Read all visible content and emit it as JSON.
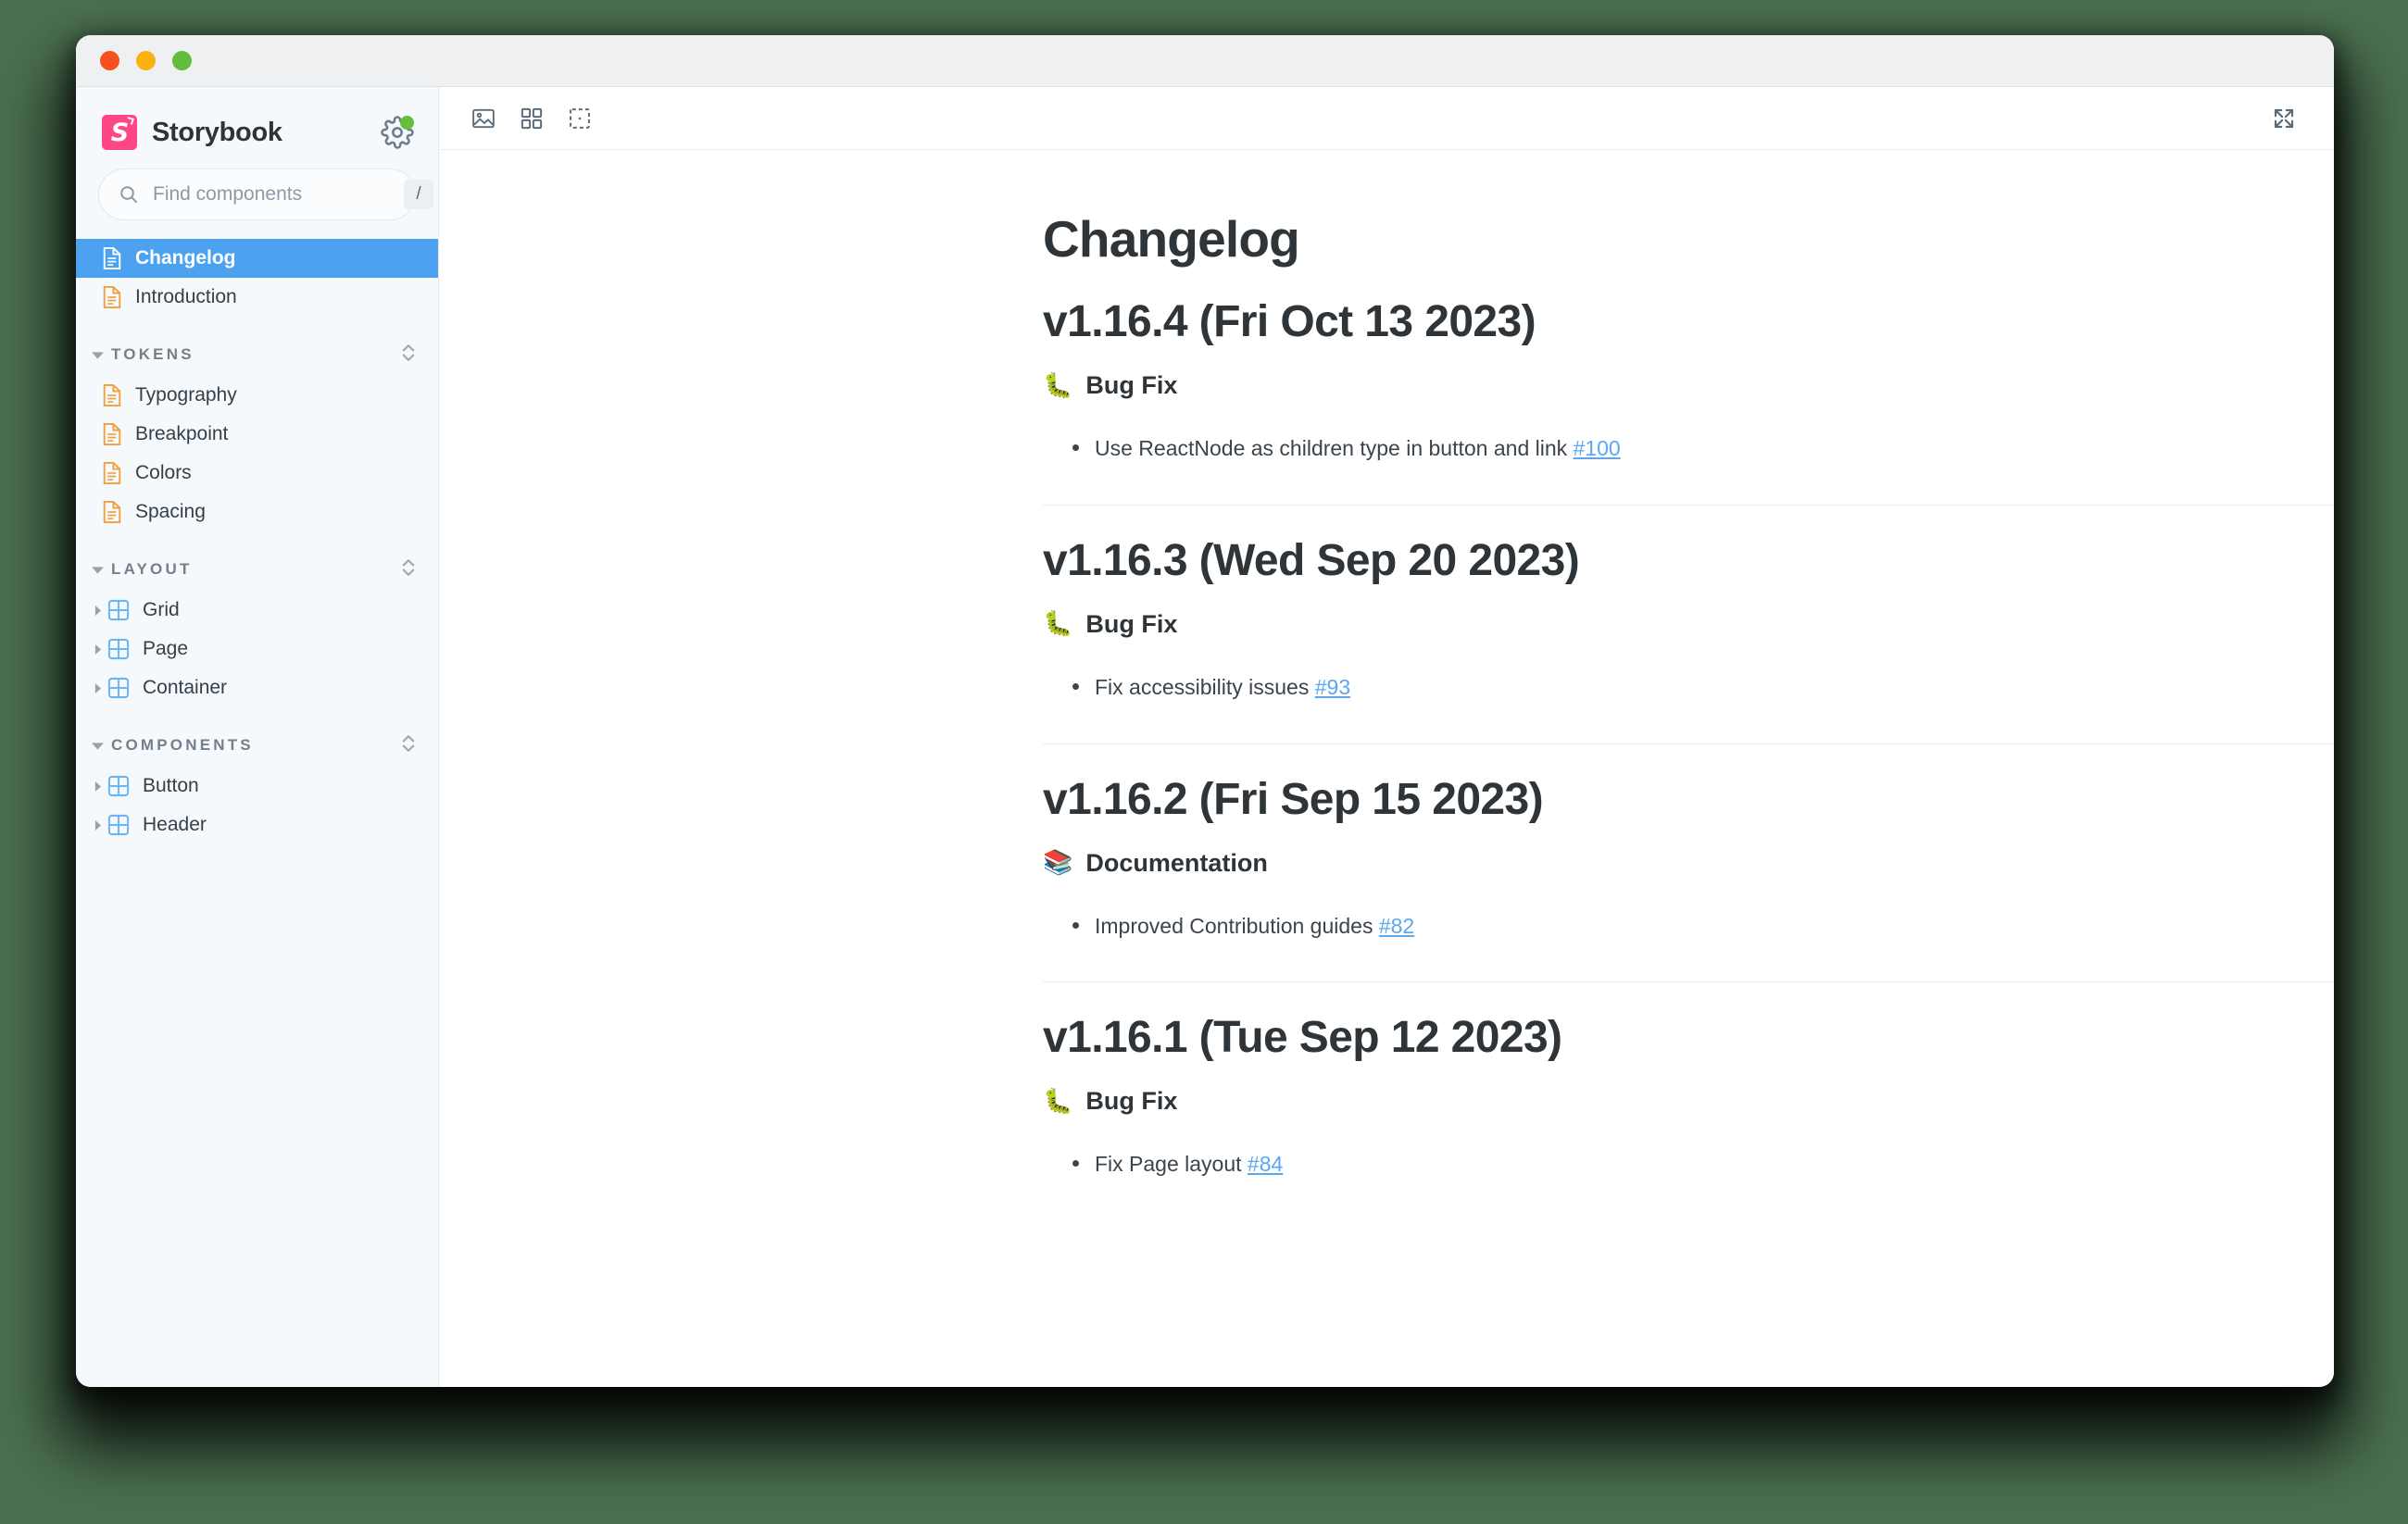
{
  "window": {
    "traffic_lights": [
      "close",
      "minimize",
      "zoom"
    ]
  },
  "sidebar": {
    "brand": "Storybook",
    "logo_mark": "S",
    "settings_icon": "gear-icon",
    "status_dot_color": "#66bf3c",
    "search": {
      "placeholder": "Find components",
      "value": "",
      "shortcut": "/"
    },
    "root_items": [
      {
        "label": "Changelog",
        "icon": "document-icon",
        "active": true
      },
      {
        "label": "Introduction",
        "icon": "document-icon",
        "active": false
      }
    ],
    "groups": [
      {
        "title": "TOKENS",
        "expanded": true,
        "items": [
          {
            "label": "Typography",
            "icon": "document-icon",
            "type": "doc"
          },
          {
            "label": "Breakpoint",
            "icon": "document-icon",
            "type": "doc"
          },
          {
            "label": "Colors",
            "icon": "document-icon",
            "type": "doc"
          },
          {
            "label": "Spacing",
            "icon": "document-icon",
            "type": "doc"
          }
        ]
      },
      {
        "title": "LAYOUT",
        "expanded": true,
        "items": [
          {
            "label": "Grid",
            "icon": "component-icon",
            "type": "component"
          },
          {
            "label": "Page",
            "icon": "component-icon",
            "type": "component"
          },
          {
            "label": "Container",
            "icon": "component-icon",
            "type": "component"
          }
        ]
      },
      {
        "title": "COMPONENTS",
        "expanded": true,
        "items": [
          {
            "label": "Button",
            "icon": "component-icon",
            "type": "component"
          },
          {
            "label": "Header",
            "icon": "component-icon",
            "type": "component"
          }
        ]
      }
    ]
  },
  "toolbar": {
    "left_buttons": [
      {
        "name": "image-icon"
      },
      {
        "name": "grid-icon"
      },
      {
        "name": "measure-icon"
      }
    ],
    "right_buttons": [
      {
        "name": "fullscreen-icon"
      }
    ]
  },
  "doc": {
    "title": "Changelog",
    "releases": [
      {
        "version": "v1.16.4 (Fri Oct 13 2023)",
        "category": "Bug Fix",
        "category_emoji": "🐛",
        "changes": [
          {
            "text": "Use ReactNode as children type in button and link",
            "ref": "#100"
          }
        ],
        "divider": true
      },
      {
        "version": "v1.16.3 (Wed Sep 20 2023)",
        "category": "Bug Fix",
        "category_emoji": "🐛",
        "changes": [
          {
            "text": "Fix accessibility issues",
            "ref": "#93"
          }
        ],
        "divider": true
      },
      {
        "version": "v1.16.2 (Fri Sep 15 2023)",
        "category": "Documentation",
        "category_emoji": "📚",
        "changes": [
          {
            "text": "Improved Contribution guides",
            "ref": "#82"
          }
        ],
        "divider": true
      },
      {
        "version": "v1.16.1 (Tue Sep 12 2023)",
        "category": "Bug Fix",
        "category_emoji": "🐛",
        "changes": [
          {
            "text": "Fix Page layout",
            "ref": "#84"
          }
        ],
        "divider": false
      }
    ]
  },
  "colors": {
    "brand_pink": "#ff4785",
    "active_blue": "#4ca2f0",
    "link_blue": "#5ba7f0",
    "doc_icon_orange": "#f2a03d",
    "component_icon_blue": "#6cb6f5",
    "backdrop_green": "#4b7050"
  }
}
